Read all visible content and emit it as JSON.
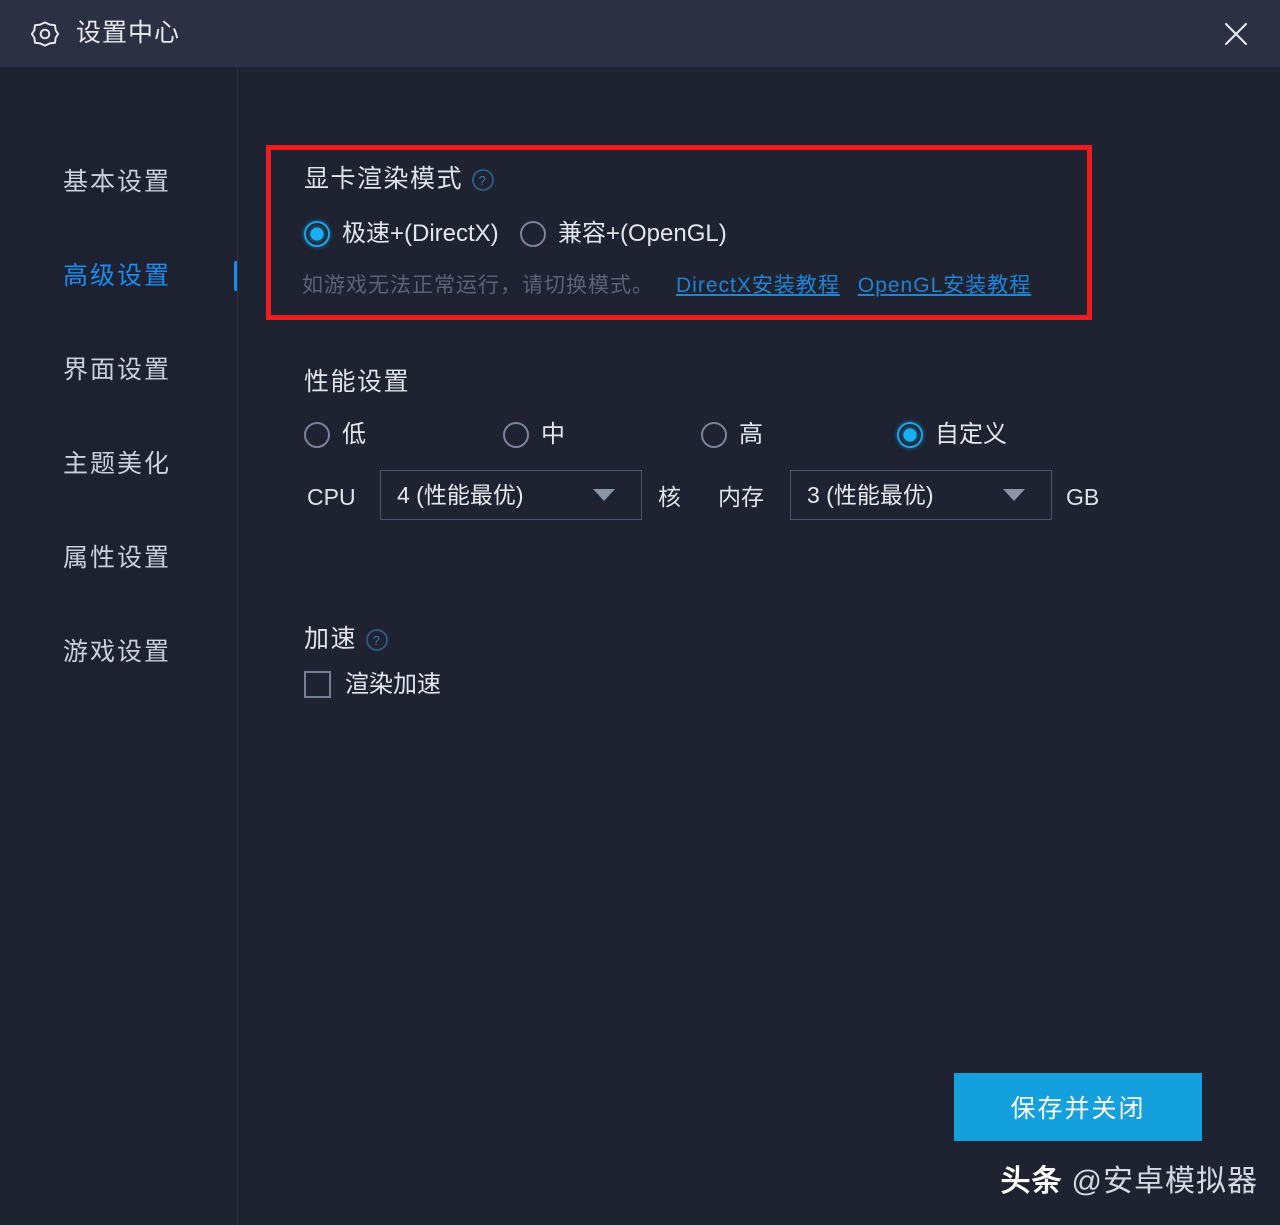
{
  "window": {
    "title": "设置中心",
    "gear_icon": "gear-icon",
    "close_icon": "close-icon",
    "titlebar_bg": "#2b3043",
    "body_bg": "#1e2231"
  },
  "sidebar": {
    "items": [
      {
        "label": "基本设置",
        "active": false
      },
      {
        "label": "高级设置",
        "active": true
      },
      {
        "label": "界面设置",
        "active": false
      },
      {
        "label": "主题美化",
        "active": false
      },
      {
        "label": "属性设置",
        "active": false
      },
      {
        "label": "游戏设置",
        "active": false
      }
    ],
    "active_color": "#1a8cf0"
  },
  "render_mode": {
    "title": "显卡渲染模式",
    "help_icon": "help-circle-icon",
    "highlight_color": "#ee1c1c",
    "options": [
      {
        "label": "极速+(DirectX)",
        "checked": true
      },
      {
        "label": "兼容+(OpenGL)",
        "checked": false
      }
    ],
    "hint": "如游戏无法正常运行，请切换模式。",
    "links": [
      {
        "label": "DirectX安装教程"
      },
      {
        "label": "OpenGL安装教程"
      }
    ],
    "link_color": "#1d84d6"
  },
  "performance": {
    "title": "性能设置",
    "options": [
      {
        "label": "低",
        "checked": false
      },
      {
        "label": "中",
        "checked": false
      },
      {
        "label": "高",
        "checked": false
      },
      {
        "label": "自定义",
        "checked": true
      }
    ],
    "cpu": {
      "label": "CPU",
      "value": "4 (性能最优)",
      "unit": "核",
      "arrow_icon": "chevron-down-icon"
    },
    "memory": {
      "label": "内存",
      "value": "3 (性能最优)",
      "unit": "GB",
      "arrow_icon": "chevron-down-icon"
    }
  },
  "acceleration": {
    "title": "加速",
    "help_icon": "help-circle-icon",
    "checkbox": {
      "label": "渲染加速",
      "checked": false
    }
  },
  "footer": {
    "save_label": "保存并关闭",
    "save_color": "#13a0dd"
  },
  "watermark": {
    "brand": "头条",
    "handle": "@安卓模拟器"
  }
}
